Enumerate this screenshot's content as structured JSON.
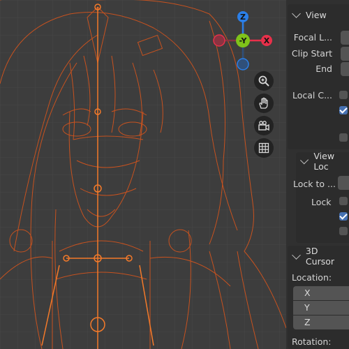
{
  "gizmo": {
    "z_label": "Z",
    "y_label": "-Y",
    "x_label": "X"
  },
  "view_panel": {
    "title": "View",
    "focal_length": "Focal L...",
    "clip_start": "Clip Start",
    "clip_end": "End",
    "local_camera": "Local C..."
  },
  "view_lock_panel": {
    "title": "View Loc",
    "lock_to_object": "Lock to ...",
    "lock": "Lock"
  },
  "cursor_panel": {
    "title": "3D Cursor",
    "location": "Location:",
    "x": "X",
    "y": "Y",
    "z": "Z",
    "rotation": "Rotation:"
  },
  "colors": {
    "mesh": "#e0561a",
    "x_axis": "#e8304a",
    "y_axis": "#7fc31a",
    "z_axis": "#2b7fe8",
    "checkbox_on": "#4772b3"
  }
}
